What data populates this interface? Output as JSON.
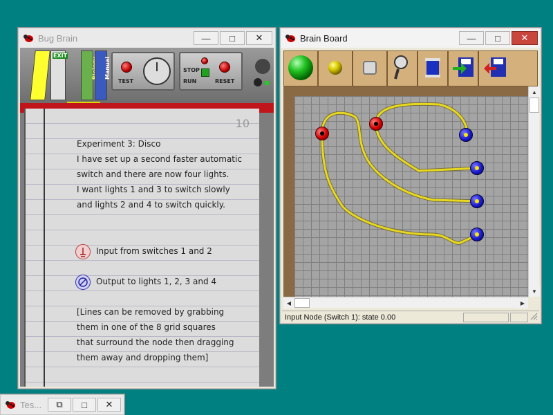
{
  "bug_brain": {
    "title": "Bug Brain",
    "buttons": {
      "minimize": "—",
      "maximize": "□",
      "close": "✕"
    },
    "panel": {
      "test_label": "TEST",
      "stop_label": "STOP",
      "run_label": "RUN",
      "reset_label": "RESET",
      "exit_label": "EXIT",
      "book1": "Biology",
      "book2": "Manual"
    },
    "notebook": {
      "page_number": "10",
      "lines": [
        "Experiment 3: Disco",
        "I have set up a second faster automatic",
        "switch and there are now four lights.",
        "I want lights 1 and 3 to switch slowly",
        "and lights 2 and 4 to switch quickly."
      ],
      "input_text": "Input from switches 1 and 2",
      "output_text": "Output to lights 1, 2, 3 and 4",
      "note_lines": [
        "[Lines can be removed by grabbing",
        "them in one of the 8 grid squares",
        "that surround the node then dragging",
        "them away and dropping them]"
      ]
    }
  },
  "brain_board": {
    "title": "Brain Board",
    "buttons": {
      "minimize": "—",
      "maximize": "□",
      "close": "✕"
    },
    "toolbar_icons": [
      "green-ball-icon",
      "yellow-ball-icon",
      "grey-square-icon",
      "magnifier-icon",
      "spool-icon",
      "load-icon",
      "save-icon"
    ],
    "status": {
      "text": "Input Node (Switch 1): state   0.00"
    }
  },
  "test_window": {
    "title": "Tes...",
    "buttons": {
      "restore": "⧉",
      "maximize": "□",
      "close": "✕"
    }
  },
  "colors": {
    "desktop": "#008080",
    "input_node": "#d00000",
    "output_node": "#1a1acc",
    "wire": "#e0d020"
  }
}
